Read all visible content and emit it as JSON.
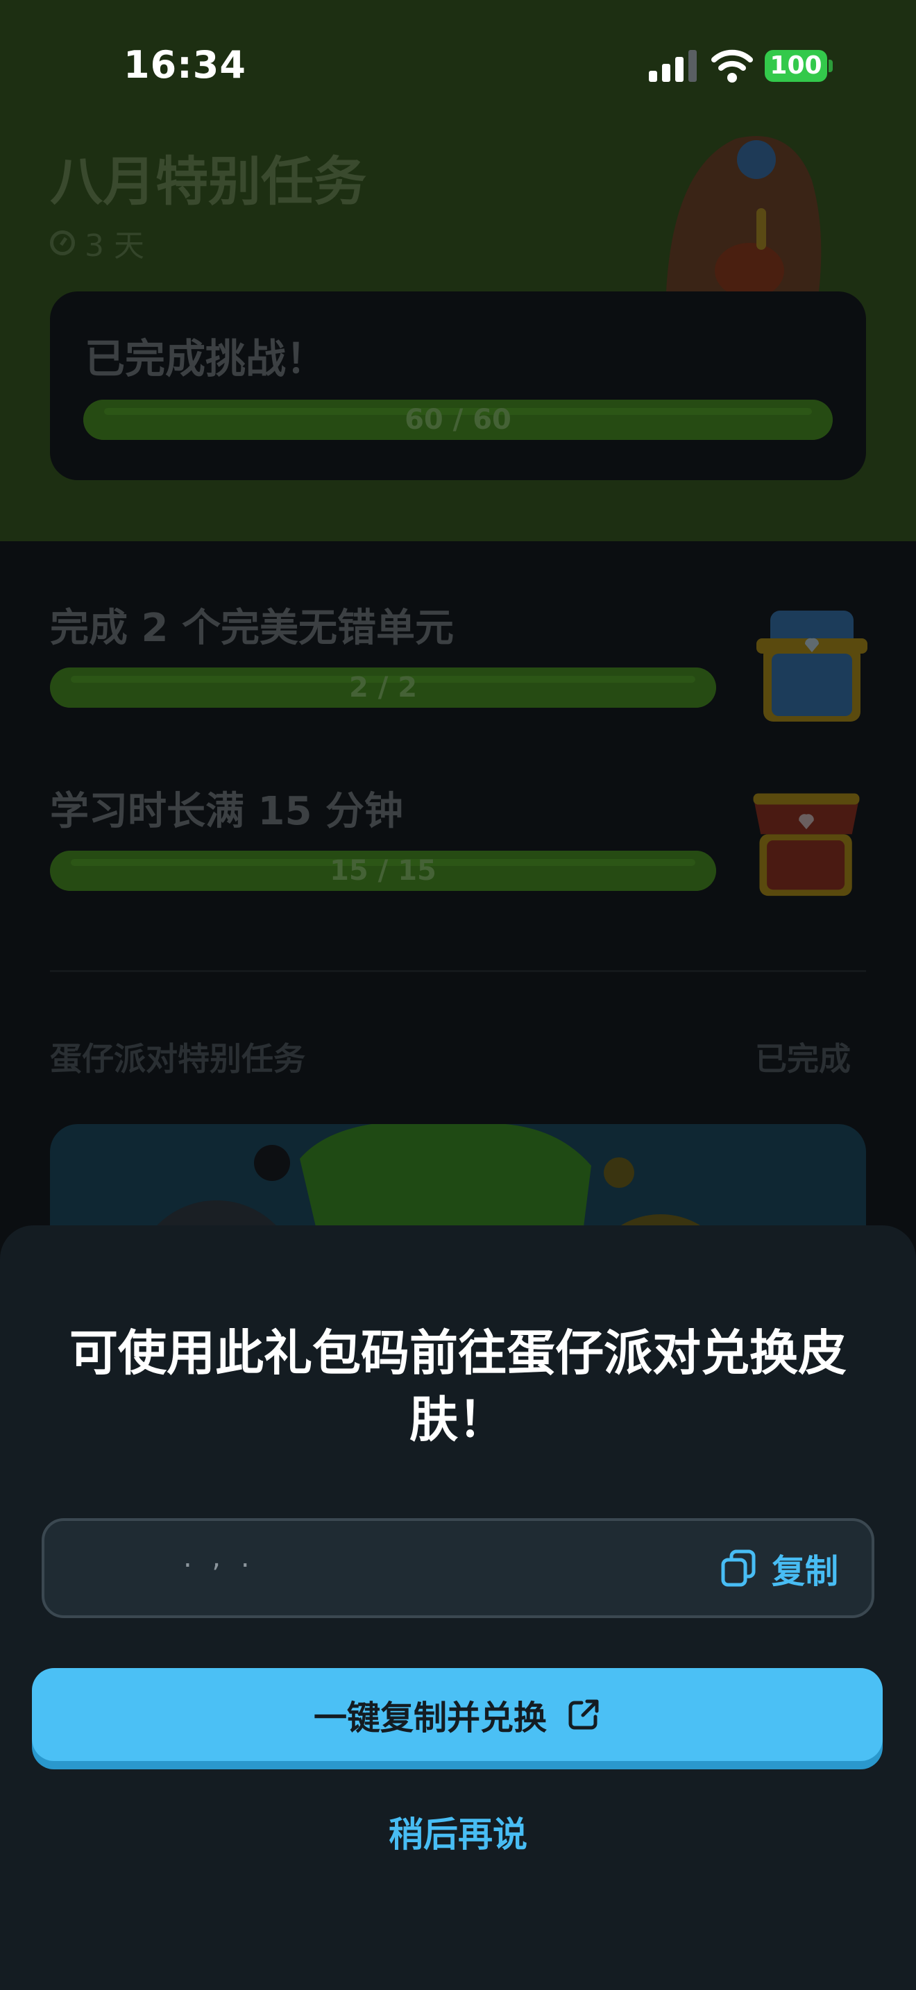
{
  "status_bar": {
    "time": "16:34",
    "battery": "100"
  },
  "quest": {
    "title": "八月特别任务",
    "time_left": "3 天",
    "challenge_label": "已完成挑战！",
    "challenge_progress": {
      "text": "60 / 60",
      "fraction": 1.0
    }
  },
  "tasks": [
    {
      "label": "完成 2 个完美无错单元",
      "progress_text": "2 / 2",
      "fraction": 1.0,
      "reward_icon": "blue-chest-icon"
    },
    {
      "label": "学习时长满 15 分钟",
      "progress_text": "15 / 15",
      "fraction": 1.0,
      "reward_icon": "red-chest-icon"
    }
  ],
  "party": {
    "title": "蛋仔派对特别任务",
    "status": "已完成"
  },
  "sheet": {
    "title": "可使用此礼包码前往蛋仔派对兑换皮肤！",
    "code_value": ". , .",
    "copy_label": "复制",
    "primary_label": "一键复制并兑换",
    "later_label": "稍后再说"
  },
  "colors": {
    "accent": "#4bc0f5",
    "sheet_bg": "#141c22",
    "progress_green": "#264b13"
  }
}
